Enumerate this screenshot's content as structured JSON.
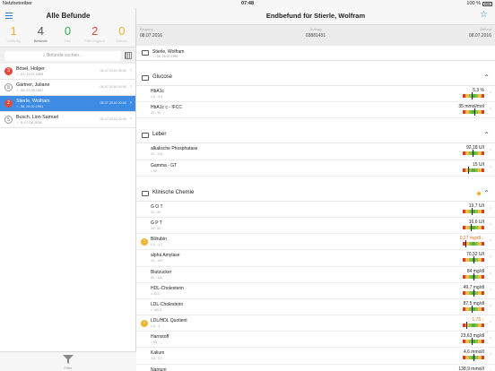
{
  "status": {
    "carrier": "Netzbetreiber",
    "time": "07:48",
    "battery": "100 %"
  },
  "left": {
    "title": "Alle Befunde",
    "stats": [
      {
        "n": "1",
        "label": "Vorläufig",
        "color": "#f0b030"
      },
      {
        "n": "4",
        "label": "Befunde",
        "color": "#555555"
      },
      {
        "n": "0",
        "label": "Neu",
        "color": "#2fb44a"
      },
      {
        "n": "2",
        "label": "Pathologisch",
        "color": "#e04a3c"
      },
      {
        "n": "0",
        "label": "Kritisch",
        "color": "#f0b030"
      }
    ],
    "search_placeholder": "Befunde suchen...",
    "patients": [
      {
        "name": "Bösel, Holger",
        "sub": "♂, 57, 11.07.1959",
        "date": "08.07.2016 00:00",
        "badge": "3",
        "badge_type": "red"
      },
      {
        "name": "Gärtner, Juliane",
        "sub": "♀, 49, 27.09.1967",
        "date": "08.07.2016 00:00",
        "badge": "8",
        "badge_type": "outline"
      },
      {
        "name": "Stierle, Wolfram",
        "sub": "♂, 58, 26.02.1961",
        "date": "08.07.2016 00:00",
        "badge": "2",
        "badge_type": "red"
      },
      {
        "name": "Busch, Lion Samuel",
        "sub": "♂, 9, 07.08.2016",
        "date": "08.07.2016 00:00",
        "badge": "5",
        "badge_type": "outline"
      }
    ],
    "filter_label": "Filter"
  },
  "right": {
    "title": "Endbefund für Stierle, Wolfram",
    "info": [
      {
        "k": "Eingang",
        "v": "08.07.2016"
      },
      {
        "k": "Auftrag",
        "v": "03881431"
      },
      {
        "k": "Befund",
        "v": "08.07.2016"
      }
    ],
    "patient": {
      "name": "Stierle, Wolfram",
      "sub": "♂, 55, 26.02.1961"
    },
    "sections": [
      {
        "title": "Glucose",
        "warn": false,
        "rows": [
          {
            "name": "HbA1c",
            "range": "4,5 - 5,9",
            "value": "5,3 %",
            "level": 0.45,
            "warn": false
          },
          {
            "name": "HbA1c c - IFCC",
            "range": "22 - 40",
            "value": "35 mmol/mol",
            "level": 0.6,
            "warn": false
          }
        ]
      },
      {
        "title": "Leber",
        "warn": false,
        "rows": [
          {
            "name": "alkalische Phosphatase",
            "range": "40 - 130",
            "value": "92,18 U/l",
            "level": 0.5,
            "warn": false
          },
          {
            "name": "Gamma - GT",
            "range": "< 60",
            "value": "15 U/l",
            "level": 0.3,
            "warn": false
          }
        ]
      },
      {
        "title": "Klinische Chemie",
        "warn": true,
        "rows": [
          {
            "name": "G O T",
            "range": "10 - 50",
            "value": "19,7 U/l",
            "level": 0.45,
            "warn": false
          },
          {
            "name": "G P T",
            "range": "10 - 50",
            "value": "16,6 U/l",
            "level": 0.4,
            "warn": false
          },
          {
            "name": "Bilirubin",
            "range": "0,0 - 1,2",
            "value": "0,27 mg/dl ↓",
            "level": 0.15,
            "warn": true
          },
          {
            "name": "alpha Amylase",
            "range": "28 - 100",
            "value": "70,32 U/l",
            "level": 0.55,
            "warn": false
          },
          {
            "name": "Blutzucker",
            "range": "60 - 100",
            "value": "84 mg/dl",
            "level": 0.55,
            "warn": false
          },
          {
            "name": "HDL-Cholesterin",
            "range": "> 35,0",
            "value": "49,7 mg/dl",
            "level": 0.55,
            "warn": false
          },
          {
            "name": "LDL-Cholesterin",
            "range": "< 160,0",
            "value": "87,5 mg/dl",
            "level": 0.45,
            "warn": false
          },
          {
            "name": "LDL/HDL Quotient",
            "range": "2,5 - 4",
            "value": "1,76 ↓",
            "level": 0.2,
            "warn": true
          },
          {
            "name": "Harnstoff",
            "range": "< 50",
            "value": "23,63 mg/dl",
            "level": 0.45,
            "warn": false
          },
          {
            "name": "Kalium",
            "range": "3,6 - 5,1",
            "value": "4,6 mmol/l",
            "level": 0.55,
            "warn": false
          },
          {
            "name": "Natrium",
            "range": "136 - 145",
            "value": "138,9 mmol/l",
            "level": 0.45,
            "warn": false
          }
        ]
      }
    ]
  }
}
